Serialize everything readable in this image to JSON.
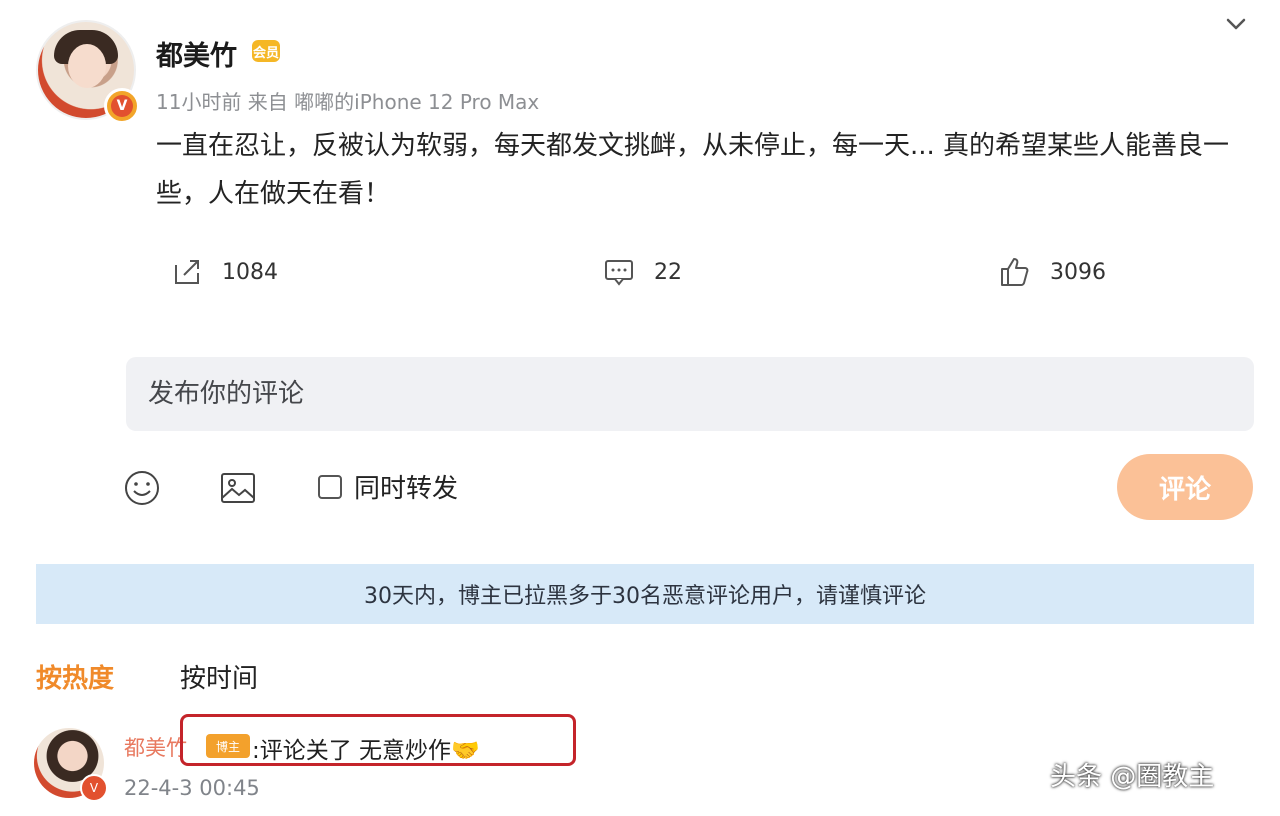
{
  "post": {
    "author": "都美竹",
    "verified_badge": "V",
    "vip_badge": "会员",
    "meta": "11小时前  来自 嘟嘟的iPhone 12 Pro Max",
    "text": "一直在忍让，反被认为软弱，每天都发文挑衅，从未停止，每一天... 真的希望某些人能善良一些，人在做天在看！"
  },
  "actions": {
    "repost_count": "1084",
    "comment_count": "22",
    "like_count": "3096"
  },
  "compose": {
    "placeholder": "发布你的评论",
    "repost_label": "同时转发",
    "submit_label": "评论"
  },
  "notice": "30天内，博主已拉黑多于30名恶意评论用户，请谨慎评论",
  "sort": {
    "hot_label": "按热度",
    "time_label": "按时间"
  },
  "comment": {
    "author": "都美竹",
    "tag": "博主",
    "text": ":评论关了 无意炒作🤝",
    "time": "22-4-3 00:45"
  },
  "watermark": "头条 @圈教主",
  "colors": {
    "accent_orange": "#f08a2a",
    "submit_button": "#fbc197",
    "notice_bg": "#d7e9f8",
    "highlight_border": "#c4242a"
  },
  "icons": [
    "chevron-down-icon",
    "repost-icon",
    "comment-icon",
    "like-icon",
    "emoji-icon",
    "image-icon"
  ]
}
